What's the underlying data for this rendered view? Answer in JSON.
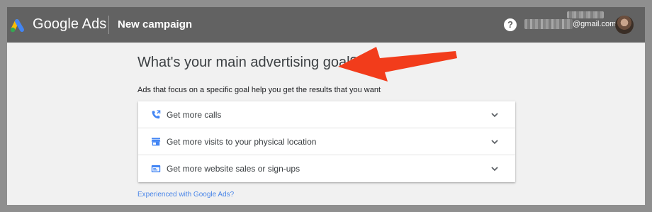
{
  "header": {
    "brand": "Google Ads",
    "page_title": "New campaign",
    "help_glyph": "?",
    "account_email": "@gmail.com",
    "logo_icon": "google-ads-logo",
    "avatar_icon": "user-avatar"
  },
  "main": {
    "heading": "What's your main advertising goal?",
    "subheading": "Ads that focus on a specific goal help you get the results that you want",
    "goals": [
      {
        "label": "Get more calls",
        "icon": "phone-icon"
      },
      {
        "label": "Get more visits to your physical location",
        "icon": "store-icon"
      },
      {
        "label": "Get more website sales or sign-ups",
        "icon": "web-icon"
      }
    ],
    "experienced_link": "Experienced with Google Ads?"
  },
  "colors": {
    "topbar": "#626262",
    "accent_blue": "#4a86e8",
    "annotation_arrow": "#f23c1b",
    "logo_yellow": "#fbbc04",
    "logo_blue": "#4285f4",
    "logo_green": "#34a853"
  }
}
